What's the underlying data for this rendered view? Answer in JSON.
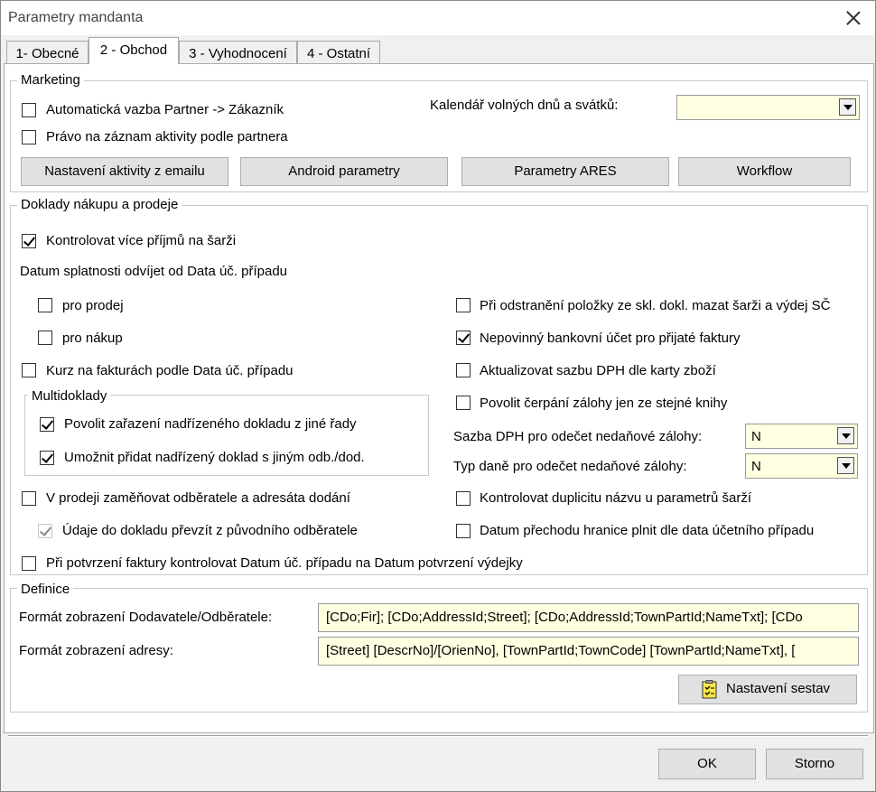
{
  "window": {
    "title": "Parametry mandanta"
  },
  "tabs": [
    {
      "label": "1- Obecné"
    },
    {
      "label": "2 - Obchod"
    },
    {
      "label": "3 - Vyhodnocení"
    },
    {
      "label": "4 - Ostatní"
    }
  ],
  "marketing": {
    "title": "Marketing",
    "cb_auto_vazba": "Automatická vazba Partner -> Zákazník",
    "cb_pravo": "Právo na záznam aktivity podle partnera",
    "kalendar_label": "Kalendář volných dnů a svátků:",
    "kalendar_value": "",
    "buttons": {
      "email": "Nastavení aktivity z emailu",
      "android": "Android parametry",
      "ares": "Parametry ARES",
      "workflow": "Workflow"
    }
  },
  "doklady": {
    "title": "Doklady nákupu a prodeje",
    "cb_kontrolovat": "Kontrolovat více příjmů na šarži",
    "datum_label": "Datum splatnosti odvíjet od Data úč. případu",
    "cb_prodej": "pro prodej",
    "cb_nakup": "pro nákup",
    "cb_kurz": "Kurz na fakturách podle Data úč. případu",
    "multi_title": "Multidoklady",
    "cb_zarazeni": "Povolit zařazení nadřízeného dokladu z jiné řady",
    "cb_umoznit": "Umožnit přidat nadřízený doklad s jiným odb./dod.",
    "cb_zamenovat": "V prodeji zaměňovat odběratele a adresáta dodání",
    "cb_udaje": "Údaje do dokladu převzít z původního odběratele",
    "cb_potvrzeni": "Při potvrzení faktury kontrolovat Datum úč. případu na Datum potvrzení výdejky",
    "cb_odstraneni": "Při odstranění položky ze skl. dokl. mazat šarži a výdej SČ",
    "cb_bankovni": "Nepovinný bankovní účet pro přijaté faktury",
    "cb_aktualizovat": "Aktualizovat sazbu DPH dle karty zboží",
    "cb_cerpani": "Povolit čerpání zálohy jen ze stejné knihy",
    "sazba_label": "Sazba DPH pro odečet nedaňové zálohy:",
    "sazba_value": "N",
    "typ_label": "Typ daně pro odečet nedaňové zálohy:",
    "typ_value": "N",
    "cb_duplicita": "Kontrolovat duplicitu názvu u parametrů šarží",
    "cb_prechod": "Datum přechodu hranice plnit dle data účetního případu"
  },
  "definice": {
    "title": "Definice",
    "format_dod_label": "Formát zobrazení Dodavatele/Odběratele:",
    "format_dod_value": "[CDo;Fir]; [CDo;AddressId;Street]; [CDo;AddressId;TownPartId;NameTxt]; [CDo",
    "format_adr_label": "Formát zobrazení adresy:",
    "format_adr_value": "[Street] [DescrNo]/[OrienNo], [TownPartId;TownCode]  [TownPartId;NameTxt], [",
    "nastaveni_sestav": "Nastavení sestav"
  },
  "footer": {
    "ok": "OK",
    "storno": "Storno"
  }
}
